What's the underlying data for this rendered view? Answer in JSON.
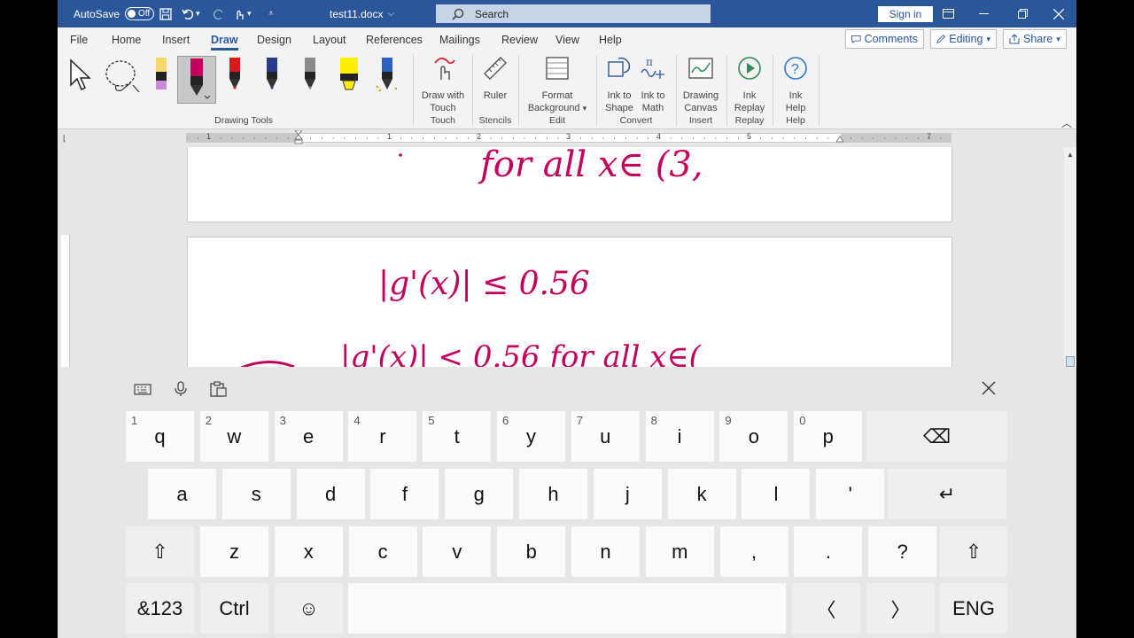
{
  "titlebar": {
    "autosave_label": "AutoSave",
    "autosave_state": "Off",
    "filename": "test11.docx",
    "search_placeholder": "Search",
    "signin_label": "Sign in"
  },
  "tabs": [
    "File",
    "Home",
    "Insert",
    "Draw",
    "Design",
    "Layout",
    "References",
    "Mailings",
    "Review",
    "View",
    "Help"
  ],
  "active_tab": "Draw",
  "ribbon_right": {
    "comments_label": "Comments",
    "editing_label": "Editing",
    "share_label": "Share"
  },
  "ribbon": {
    "drawing_tools_label": "Drawing Tools",
    "draw_with_touch": [
      "Draw with",
      "Touch"
    ],
    "touch_group": "Touch",
    "ruler": "Ruler",
    "stencils_group": "Stencils",
    "format_background": [
      "Format",
      "Background"
    ],
    "edit_group": "Edit",
    "ink_to_shape": [
      "Ink to",
      "Shape"
    ],
    "ink_to_math": [
      "Ink to",
      "Math"
    ],
    "convert_group": "Convert",
    "drawing_canvas": [
      "Drawing",
      "Canvas"
    ],
    "insert_group": "Insert",
    "ink_replay": [
      "Ink",
      "Replay"
    ],
    "replay_group": "Replay",
    "ink_help": [
      "Ink",
      "Help"
    ],
    "help_group": "Help"
  },
  "pens": [
    {
      "name": "pencil-pen-icon",
      "color": "#f3d86e"
    },
    {
      "name": "pen-magenta-icon",
      "color": "#c3005b"
    },
    {
      "name": "pen-red-icon",
      "color": "#e0151c"
    },
    {
      "name": "pen-galaxy-icon",
      "color": "#2a3b8f"
    },
    {
      "name": "pen-gray-icon",
      "color": "#8a8a8a"
    },
    {
      "name": "highlighter-yellow-icon",
      "color": "#ffee00"
    },
    {
      "name": "pen-blue-icon",
      "color": "#2b5fc4"
    }
  ],
  "ruler_numbers": [
    "1",
    "1",
    "2",
    "3",
    "4",
    "5",
    "7"
  ],
  "ink_color": "#c3005b",
  "document": {
    "ink_line_1": "for all x∈ (3,",
    "ink_line_2": "|g'(x)| ≤ 0.56",
    "ink_line_3": "|g'(x)| < 0.56  for all x∈("
  },
  "keyboard": {
    "row1": [
      {
        "key": "q",
        "hint": "1"
      },
      {
        "key": "w",
        "hint": "2"
      },
      {
        "key": "e",
        "hint": "3"
      },
      {
        "key": "r",
        "hint": "4"
      },
      {
        "key": "t",
        "hint": "5"
      },
      {
        "key": "y",
        "hint": "6"
      },
      {
        "key": "u",
        "hint": "7"
      },
      {
        "key": "i",
        "hint": "8"
      },
      {
        "key": "o",
        "hint": "9"
      },
      {
        "key": "p",
        "hint": "0"
      }
    ],
    "backspace": "⌫",
    "row2": [
      "a",
      "s",
      "d",
      "f",
      "g",
      "h",
      "j",
      "k",
      "l",
      "'"
    ],
    "enter": "↵",
    "shift": "⇧",
    "row3": [
      "z",
      "x",
      "c",
      "v",
      "b",
      "n",
      "m",
      ",",
      ".",
      "?"
    ],
    "symbols": "&123",
    "ctrl": "Ctrl",
    "emoji": "☺",
    "left": "〈",
    "right": "〉",
    "language": "ENG"
  }
}
